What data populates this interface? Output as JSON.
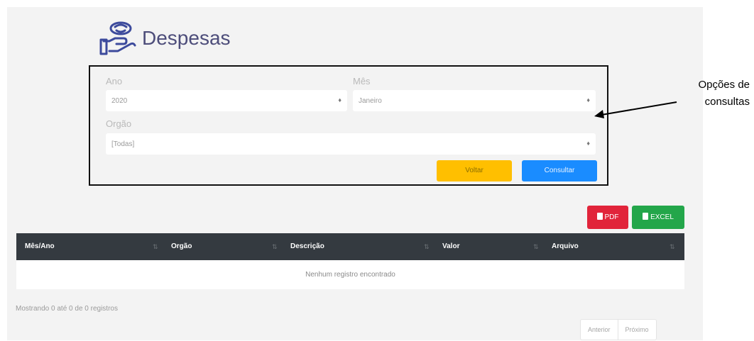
{
  "header": {
    "title": "Despesas",
    "icon": "money-hand-icon"
  },
  "filters": {
    "ano": {
      "label": "Ano",
      "value": "2020"
    },
    "mes": {
      "label": "Mês",
      "value": "Janeiro"
    },
    "orgao": {
      "label": "Orgão",
      "value": "[Todas]"
    },
    "voltar_label": "Voltar",
    "consultar_label": "Consultar"
  },
  "annotation": {
    "line1": "Opções de",
    "line2": "consultas"
  },
  "export": {
    "pdf_label": "PDF",
    "excel_label": "EXCEL"
  },
  "table": {
    "columns": [
      "Mês/Ano",
      "Orgão",
      "Descrição",
      "Valor",
      "Arquivo"
    ],
    "empty_message": "Nenhum registro encontrado"
  },
  "footer": {
    "info": "Mostrando 0 até 0 de 0 registros",
    "prev_label": "Anterior",
    "next_label": "Próximo"
  },
  "colors": {
    "voltar": "#ffbf00",
    "consultar": "#1a8cff",
    "pdf": "#e1243a",
    "excel": "#23a64a",
    "table_header": "#343a40"
  }
}
